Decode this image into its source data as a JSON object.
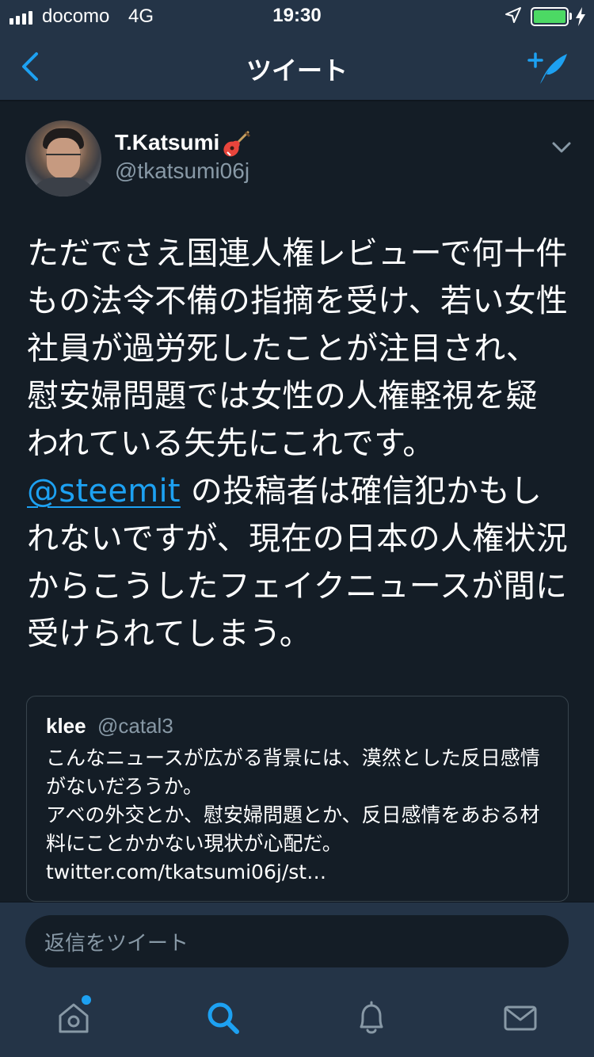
{
  "status_bar": {
    "carrier": "docomo",
    "network": "4G",
    "time": "19:30",
    "battery_level": 1.0
  },
  "nav": {
    "title": "ツイート",
    "back_icon": "chevron-left-icon",
    "compose_icon": "compose-tweet-icon"
  },
  "tweet": {
    "author_name": "T.Katsumi",
    "author_emoji_icon": "guitar-icon",
    "author_handle": "@tkatsumi06j",
    "text_before_mention": "ただでさえ国連人権レビューで何十件もの法令不備の指摘を受け、若い女性社員が過労死したことが注目され、慰安婦問題では女性の人権軽視を疑われている矢先にこれです。",
    "mention": "@steemit",
    "text_after_mention": " の投稿者は確信犯かもしれないですが、現在の日本の人権状況からこうしたフェイクニュースが間に受けられてしまう。"
  },
  "quoted_tweet": {
    "author_name": "klee",
    "author_handle": "@catal3",
    "text": "こんなニュースが広がる背景には、漠然とした反日感情がないだろうか。\nアベの外交とか、慰安婦問題とか、反日感情をあおる材料にことかかない現状が心配だ。\ntwitter.com/tkatsumi06j/st…"
  },
  "reply": {
    "placeholder": "返信をツイート"
  },
  "tab_bar": {
    "tabs": [
      {
        "icon": "home-icon",
        "active": false,
        "has_notification_dot": true
      },
      {
        "icon": "search-icon",
        "active": true
      },
      {
        "icon": "bell-icon",
        "active": false
      },
      {
        "icon": "mail-icon",
        "active": false
      }
    ]
  },
  "colors": {
    "background": "#141d26",
    "bar_background": "#243447",
    "accent": "#1da1f2",
    "secondary_text": "#8899a6"
  }
}
